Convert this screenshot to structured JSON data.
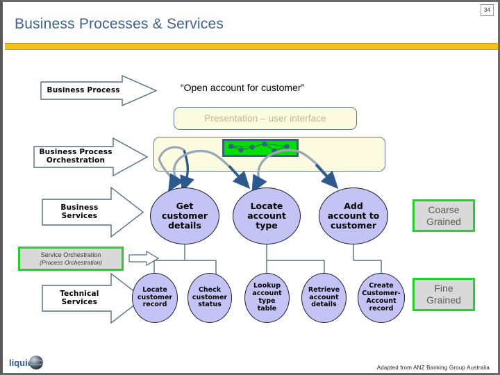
{
  "slide": {
    "page_number": "34",
    "title": "Business Processes & Services",
    "accent_bar_color": "#f5c21b",
    "title_color": "#3c6291"
  },
  "quote": {
    "text": "“Open account for customer”"
  },
  "layers": {
    "business_process": "Business Process",
    "business_process_orchestration": "Business Process\nOrchestration",
    "business_process_orchestration_line1": "Business Process",
    "business_process_orchestration_line2": "Orchestration",
    "business_services_line1": "Business",
    "business_services_line2": "Services",
    "technical_services_line1": "Technical",
    "technical_services_line2": "Services"
  },
  "banners": {
    "presentation": "Presentation – user interface",
    "presentation_text_color": "#b9b98e",
    "banner_fill": "#fcfbdf",
    "banner_border": "#5d7b8f"
  },
  "process_strip": {
    "fill_color": "#00e000",
    "border_color": "#3a5f8a",
    "node_color": "#3a5f8a",
    "node_count": 7
  },
  "business_services": [
    {
      "id": "get-customer-details",
      "lines": [
        "Get",
        "customer",
        "details"
      ]
    },
    {
      "id": "locate-account-type",
      "lines": [
        "Locate",
        "account",
        "type"
      ]
    },
    {
      "id": "add-account-to-customer",
      "lines": [
        "Add",
        "account to",
        "customer"
      ]
    }
  ],
  "technical_services": [
    {
      "id": "locate-customer-record",
      "lines": [
        "Locate",
        "customer",
        "record"
      ]
    },
    {
      "id": "check-customer-status",
      "lines": [
        "Check",
        "customer",
        "status"
      ]
    },
    {
      "id": "lookup-account-type-table",
      "lines": [
        "Lookup",
        "account",
        "type",
        "table"
      ]
    },
    {
      "id": "retrieve-account-details",
      "lines": [
        "Retrieve",
        "account",
        "details"
      ]
    },
    {
      "id": "create-customer-account-record",
      "lines": [
        "Create",
        "Customer-",
        "Account",
        "record"
      ]
    }
  ],
  "granularity": {
    "coarse_line1": "Coarse",
    "coarse_line2": "Grained",
    "fine_line1": "Fine",
    "fine_line2": "Grained",
    "box_fill": "#d9d9d9",
    "box_border": "#22d12a"
  },
  "service_orchestration": {
    "title": "Service Orchestration",
    "subtitle": "(Process Orchestration)"
  },
  "footer": {
    "logo_text": "liquid",
    "credit": "Adapted from ANZ Banking Group Australia"
  }
}
